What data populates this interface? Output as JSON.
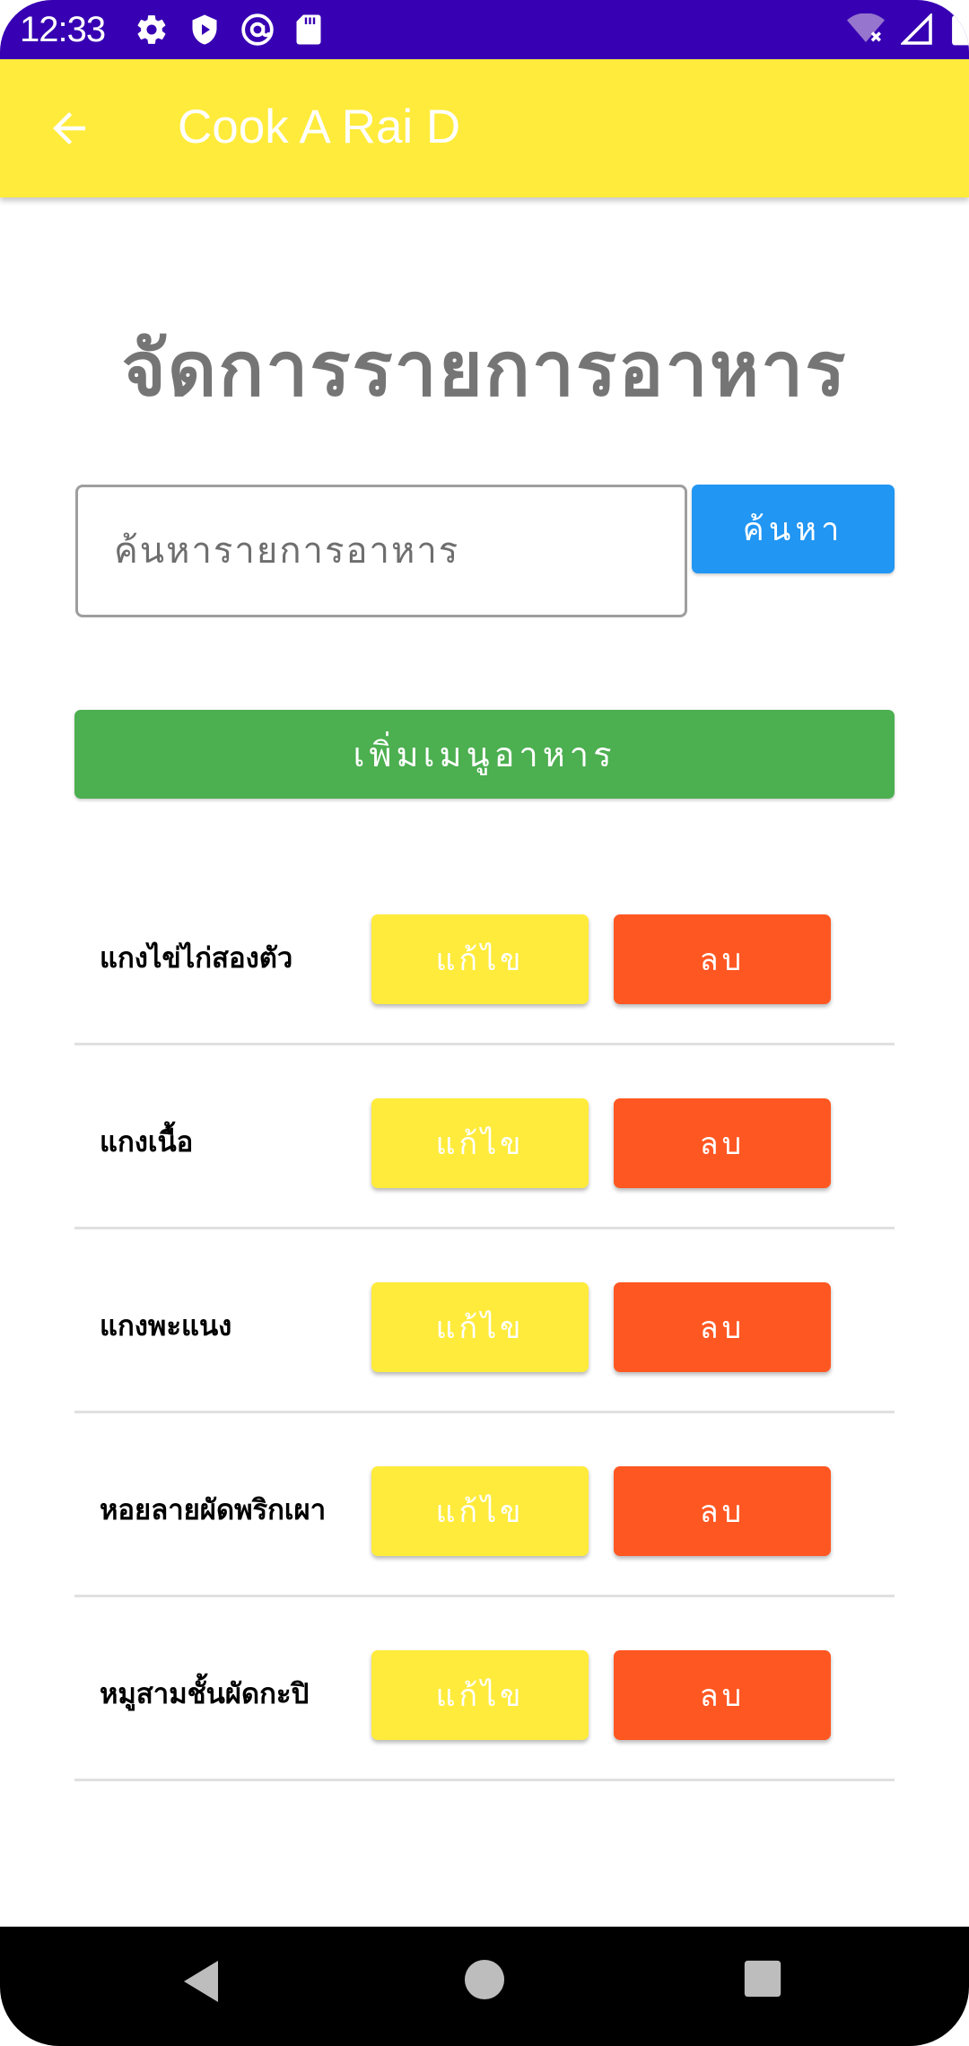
{
  "status_bar": {
    "time": "12:33",
    "icons": [
      "gear-icon",
      "play-protect-icon",
      "at-sign-icon",
      "sd-card-icon",
      "wifi-icon",
      "signal-icon",
      "battery-icon"
    ]
  },
  "app_bar": {
    "title": "Cook A Rai D",
    "back_icon": "arrow-left-icon",
    "background_color": "#ffeb3b"
  },
  "page": {
    "title": "จัดการรายการอาหาร"
  },
  "search": {
    "placeholder": "ค้นหารายการอาหาร",
    "value": "",
    "button_label": "ค้นหา",
    "button_color": "#2196f3"
  },
  "add_button": {
    "label": "เพิ่มเมนูอาหาร",
    "color": "#4caf50"
  },
  "menu_items": [
    {
      "name": "แกงไข่ไก่สองตัว",
      "edit_label": "แก้ไข",
      "delete_label": "ลบ"
    },
    {
      "name": "แกงเนื้อ",
      "edit_label": "แก้ไข",
      "delete_label": "ลบ"
    },
    {
      "name": "แกงพะแนง",
      "edit_label": "แก้ไข",
      "delete_label": "ลบ"
    },
    {
      "name": "หอยลายผัดพริกเผา",
      "edit_label": "แก้ไข",
      "delete_label": "ลบ"
    },
    {
      "name": "หมูสามชั้นผัดกะปิ",
      "edit_label": "แก้ไข",
      "delete_label": "ลบ"
    }
  ],
  "colors": {
    "status_bar": "#3700b3",
    "edit_button": "#ffeb3b",
    "delete_button": "#ff5722"
  },
  "nav_bar": {
    "icons": [
      "back-triangle-icon",
      "home-circle-icon",
      "recents-square-icon"
    ]
  }
}
